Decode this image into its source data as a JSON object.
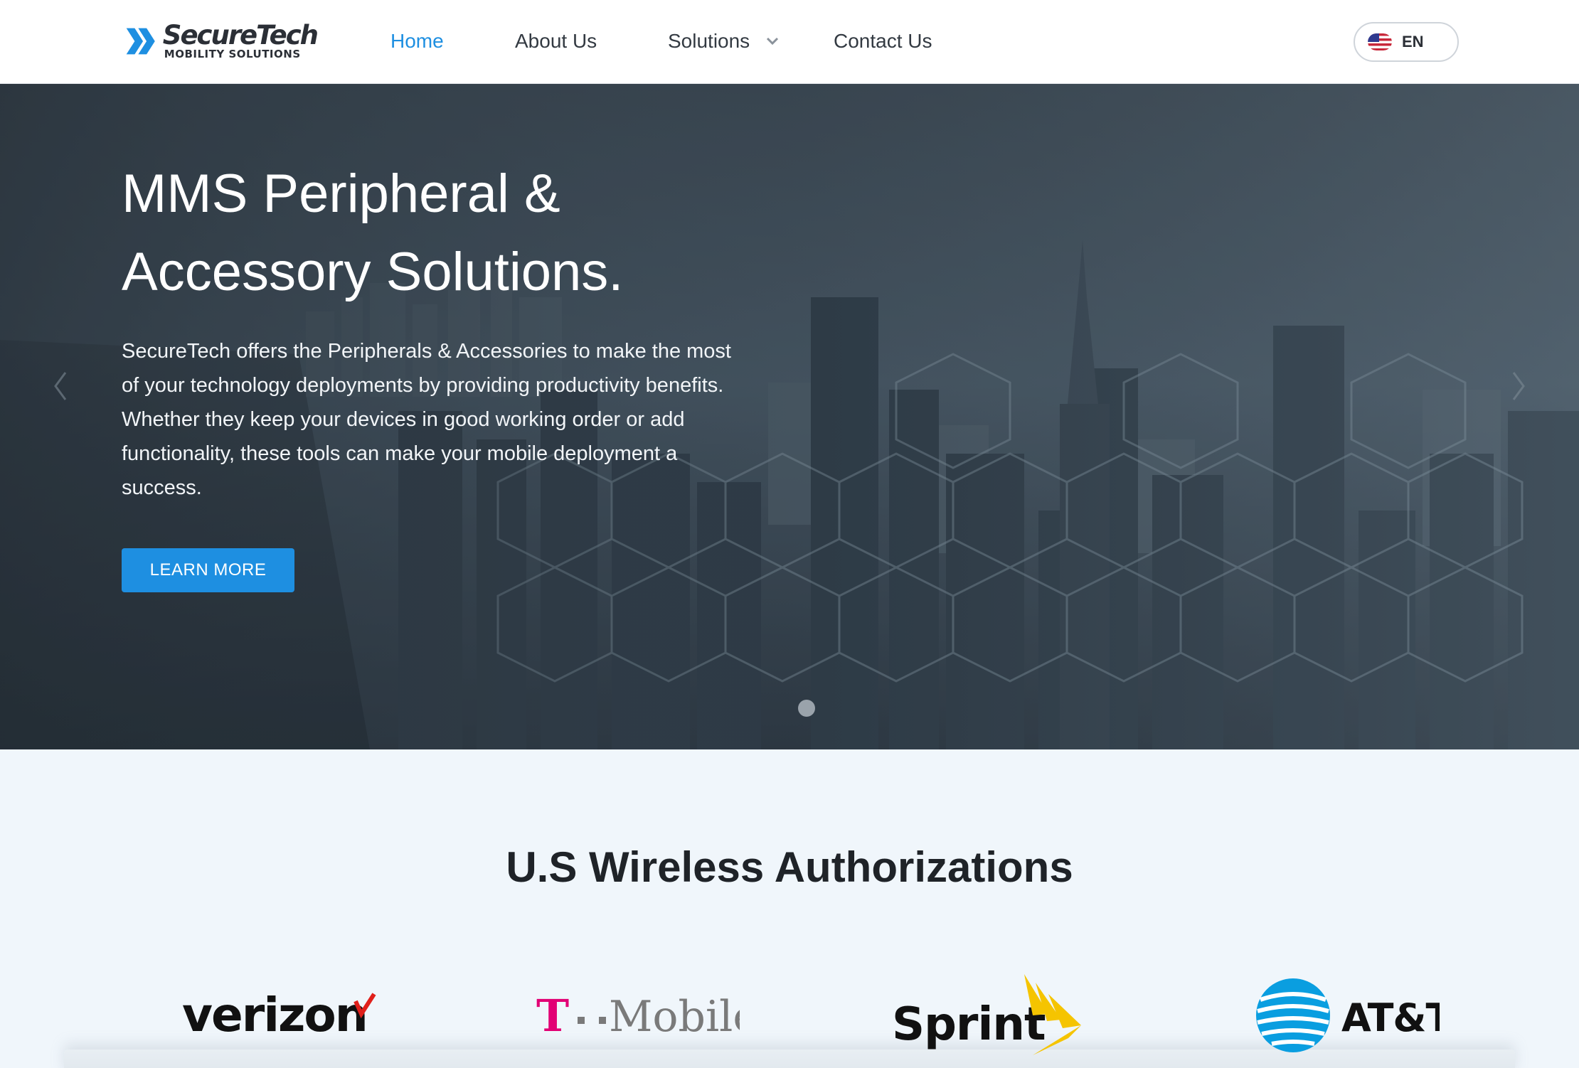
{
  "brand": {
    "name": "SecureTech",
    "tagline": "MOBILITY SOLUTIONS",
    "accent": "#1e8fe1"
  },
  "nav": {
    "home": "Home",
    "about": "About Us",
    "solutions": "Solutions",
    "contact": "Contact Us",
    "active": "Home"
  },
  "language": {
    "code": "EN",
    "flag": "us-flag-icon"
  },
  "hero": {
    "title_line1": "MMS Peripheral &",
    "title_line2": "Accessory Solutions.",
    "desc_line1": "SecureTech offers the Peripherals & Accessories to make the most",
    "desc_line2": "of your technology deployments by providing productivity benefits.",
    "desc_line3": "Whether they keep your devices in good working order or add",
    "desc_line4": "functionality, these tools can make your mobile deployment a",
    "desc_line5": "success.",
    "button": "LEARN MORE"
  },
  "authorizations": {
    "title": "U.S Wireless Authorizations",
    "carriers": {
      "verizon": "verizon",
      "tmobile_t": "T",
      "tmobile_name": "Mobile",
      "sprint": "Sprint",
      "att": "AT&T"
    }
  }
}
